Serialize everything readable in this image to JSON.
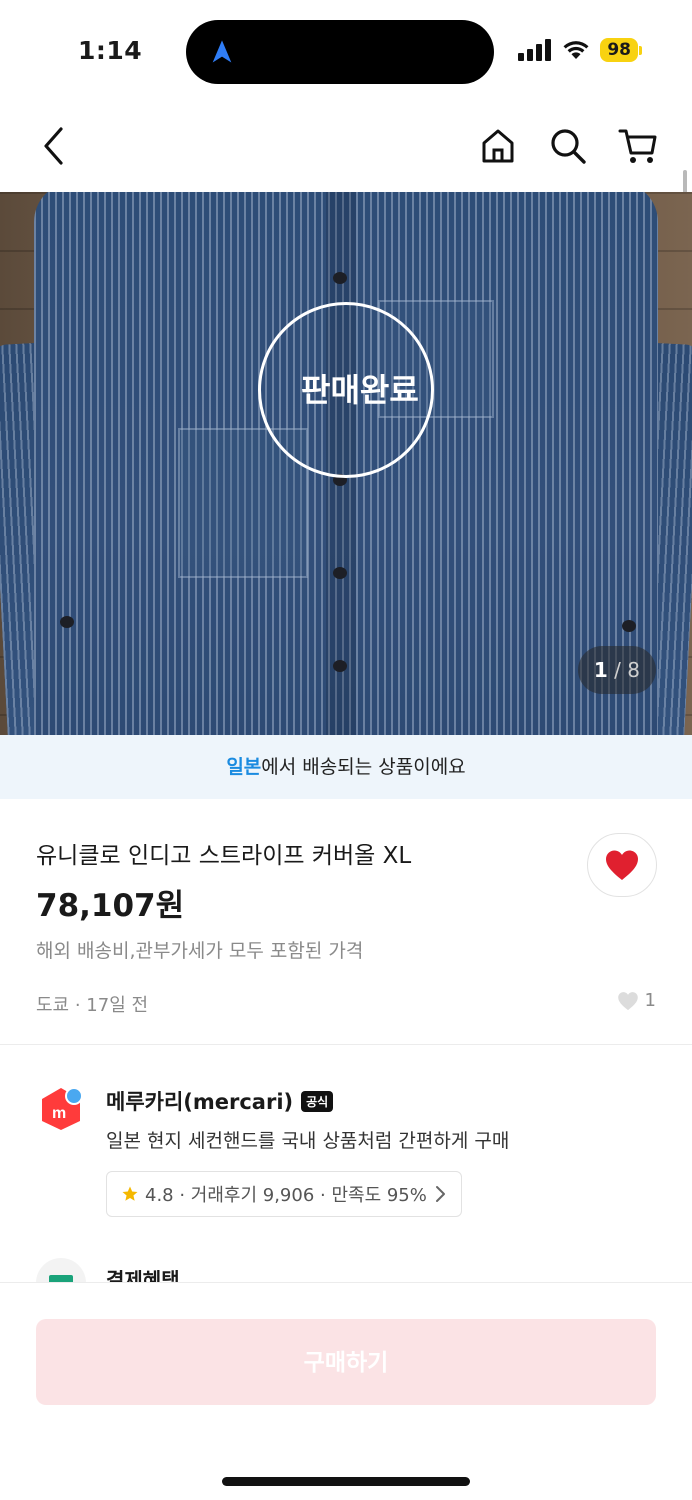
{
  "status_bar": {
    "time": "1:14",
    "battery": "98"
  },
  "header": {
    "back_icon": "chevron-left-icon",
    "home_icon": "home-icon",
    "search_icon": "search-icon",
    "cart_icon": "cart-icon"
  },
  "image": {
    "sold_label": "판매완료",
    "counter_current": "1",
    "counter_sep": "/",
    "counter_total": "8"
  },
  "ship_notice": {
    "highlight": "일본",
    "rest": "에서 배송되는 상품이에요"
  },
  "product": {
    "title": "유니클로 인디고 스트라이프 커버올 XL",
    "price": "78,107원",
    "price_note": "해외 배송비,관부가세가 모두 포함된 가격",
    "location": "도쿄 · 17일 전",
    "like_count": "1",
    "liked": true,
    "heart_color": "#e0202f"
  },
  "seller": {
    "name": "메루카리(mercari)",
    "badge": "공식",
    "description": "일본 현지 세컨핸드를 국내 상품처럼 간편하게 구매",
    "stats": "4.8 · 거래후기 9,906 · 만족도 95%",
    "logo_color": "#ff3b3b"
  },
  "payment": {
    "title": "결제혜택"
  },
  "buy_button": {
    "label": "구매하기"
  },
  "colors": {
    "accent_blue": "#1a8be0",
    "buy_disabled_bg": "#fbe3e5",
    "star": "#f5b800"
  }
}
